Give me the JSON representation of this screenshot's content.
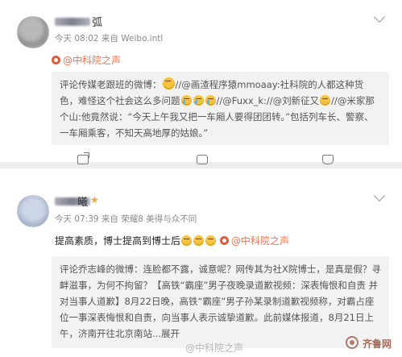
{
  "colors": {
    "accent": "#eb7350",
    "mention": "#5b86b8",
    "quote_bg": "#f2f2f2",
    "page_bg": "#ededed"
  },
  "post1": {
    "name_suffix": "弧",
    "meta": "今天 08:02 来自 Weibo.intl",
    "mention": "@中科院之声",
    "quote": {
      "prefix": "评论传媒老跟班的微博：",
      "seg1": "//@画渣程序猿mmoaay:社科院的人都这种货色，难怪这个社会这么多问题",
      "seg2": "//@Fuxx_k://@刘新征",
      "seg3": "又",
      "seg4": "//@米家那个山:他竟然说：“今天上午我又把一车厢人要得团团转。”包括列车长、警察、一车厢乘客，不知天高地厚的姑娘。”"
    },
    "actions": {
      "share": "",
      "comment": "",
      "like": ""
    }
  },
  "post2": {
    "name_suffix": "曦",
    "meta": "今天 07:39 来自 荣耀8 美得与众不同",
    "body": "提高素质，博士提高到博士后",
    "mention": "@中科院之声",
    "quote": {
      "prefix": "评论乔志峰的微博：",
      "text": "连脸都不露，诚意呢？网传其为社X院博士，是真是假？寻衅滋事，为何不拘留？【高铁“霸座”男子夜晚录道歉视频：深表悔恨和自责 并对当事人道歉】8月22日晚，高铁“霸座”男子孙某录制道歉视频称，对霸占座位一事深表悔恨和自责，向当事人表示诚挚道歉。此前媒体报道，8月21日上午，济南开往北京南站...展开"
    }
  },
  "watermarks": {
    "weibo": "@中科院之声",
    "site": "齐鲁网"
  }
}
